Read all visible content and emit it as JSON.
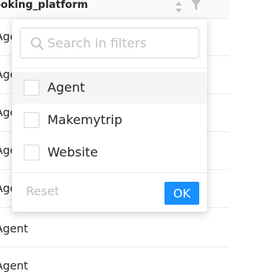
{
  "table": {
    "column_title": "ooking_platform",
    "row_values": [
      "Agen",
      "Agen",
      "Agen",
      "Agen",
      "Agen",
      "Agent",
      "Agent"
    ]
  },
  "filter": {
    "search_placeholder": "Search in filters",
    "options": [
      {
        "label": "Agent",
        "checked": false,
        "highlighted": true
      },
      {
        "label": "Makemytrip",
        "checked": false,
        "highlighted": false
      },
      {
        "label": "Website",
        "checked": false,
        "highlighted": false
      }
    ],
    "reset_label": "Reset",
    "ok_label": "OK"
  },
  "colors": {
    "primary": "#1890ff",
    "disabled_text": "#bfbfbf",
    "hover_bg": "#f5f5f5"
  }
}
